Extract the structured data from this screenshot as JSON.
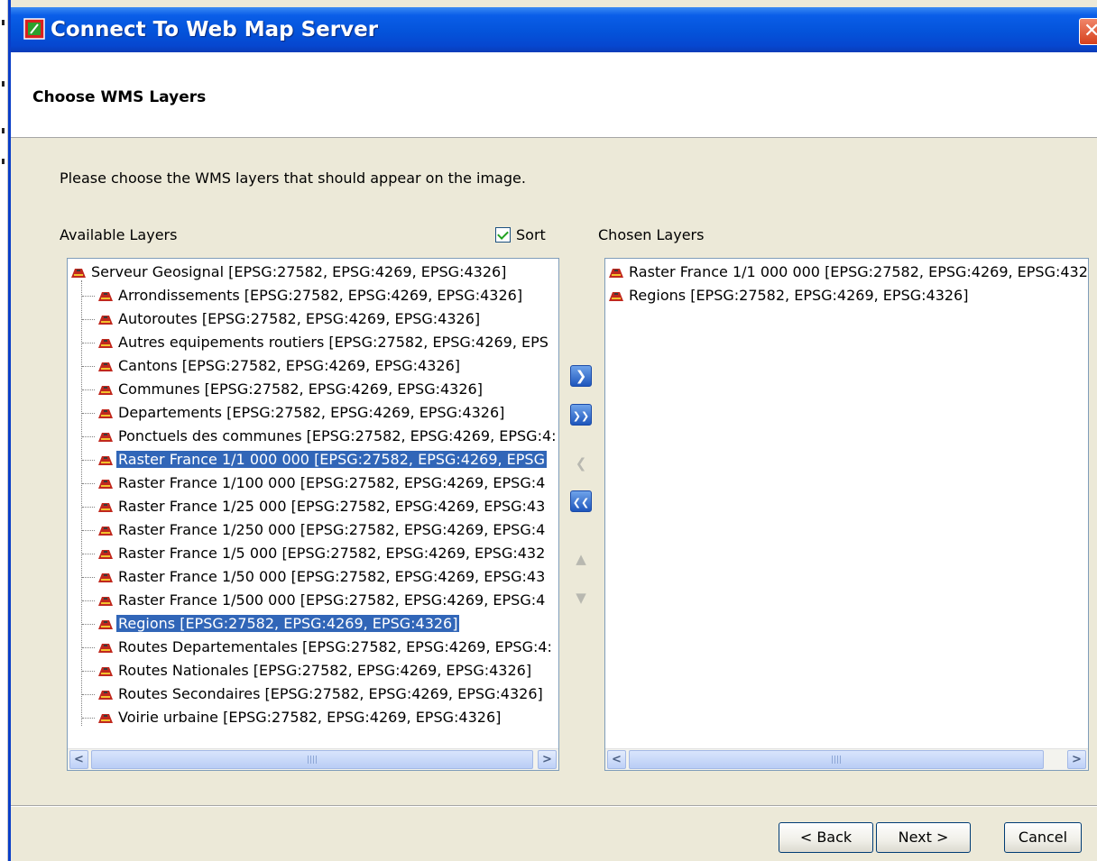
{
  "window": {
    "title": "Connect To Web Map Server"
  },
  "header": {
    "title": "Choose WMS Layers"
  },
  "instruction": "Please choose the WMS layers that should appear on the image.",
  "available": {
    "label": "Available Layers",
    "sort_label": "Sort",
    "sort_checked": true,
    "root": "Serveur Geosignal [EPSG:27582, EPSG:4269, EPSG:4326]",
    "items": [
      {
        "label": "Arrondissements [EPSG:27582, EPSG:4269, EPSG:4326]",
        "selected": false
      },
      {
        "label": "Autoroutes [EPSG:27582, EPSG:4269, EPSG:4326]",
        "selected": false
      },
      {
        "label": "Autres equipements routiers [EPSG:27582, EPSG:4269, EPS",
        "selected": false
      },
      {
        "label": "Cantons [EPSG:27582, EPSG:4269, EPSG:4326]",
        "selected": false
      },
      {
        "label": "Communes [EPSG:27582, EPSG:4269, EPSG:4326]",
        "selected": false
      },
      {
        "label": "Departements [EPSG:27582, EPSG:4269, EPSG:4326]",
        "selected": false
      },
      {
        "label": "Ponctuels des communes [EPSG:27582, EPSG:4269, EPSG:4:",
        "selected": false
      },
      {
        "label": "Raster France 1/1 000 000 [EPSG:27582, EPSG:4269, EPSG",
        "selected": true
      },
      {
        "label": "Raster France 1/100 000 [EPSG:27582, EPSG:4269, EPSG:4",
        "selected": false
      },
      {
        "label": "Raster France 1/25 000 [EPSG:27582, EPSG:4269, EPSG:43",
        "selected": false
      },
      {
        "label": "Raster France 1/250 000 [EPSG:27582, EPSG:4269, EPSG:4",
        "selected": false
      },
      {
        "label": "Raster France 1/5 000 [EPSG:27582, EPSG:4269, EPSG:432",
        "selected": false
      },
      {
        "label": "Raster France 1/50 000 [EPSG:27582, EPSG:4269, EPSG:43",
        "selected": false
      },
      {
        "label": "Raster France 1/500 000 [EPSG:27582, EPSG:4269, EPSG:4",
        "selected": false
      },
      {
        "label": "Regions [EPSG:27582, EPSG:4269, EPSG:4326]",
        "selected": true
      },
      {
        "label": "Routes Departementales [EPSG:27582, EPSG:4269, EPSG:4:",
        "selected": false
      },
      {
        "label": "Routes Nationales [EPSG:27582, EPSG:4269, EPSG:4326]",
        "selected": false
      },
      {
        "label": "Routes Secondaires [EPSG:27582, EPSG:4269, EPSG:4326]",
        "selected": false
      },
      {
        "label": "Voirie urbaine [EPSG:27582, EPSG:4269, EPSG:4326]",
        "selected": false
      }
    ]
  },
  "chosen": {
    "label": "Chosen Layers",
    "items": [
      "Raster France 1/1 000 000 [EPSG:27582, EPSG:4269, EPSG:432",
      "Regions [EPSG:27582, EPSG:4269, EPSG:4326]"
    ]
  },
  "move_buttons": [
    {
      "icon": "move-right-icon",
      "enabled": true
    },
    {
      "icon": "move-all-right-icon",
      "enabled": true
    },
    {
      "icon": "move-left-icon",
      "enabled": false
    },
    {
      "icon": "move-all-left-icon",
      "enabled": true
    },
    {
      "icon": "move-up-icon",
      "enabled": false
    },
    {
      "icon": "move-down-icon",
      "enabled": false
    }
  ],
  "buttons": {
    "back": "< Back",
    "next": "Next >",
    "cancel": "Cancel"
  },
  "colors": {
    "title_bar": "#0453da",
    "selection": "#3166b8",
    "dialog_bg": "#ece9d8"
  }
}
